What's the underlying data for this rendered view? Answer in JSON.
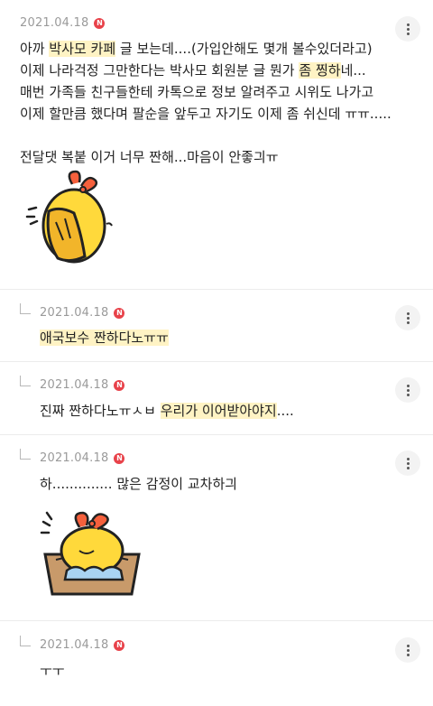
{
  "comments": [
    {
      "date": "2021.04.18",
      "badge": "N",
      "lines": [
        [
          "아까 ",
          {
            "hl": "박사모 카페"
          },
          " 글 보는데....(가입안해도 몇개 볼수있더라고)"
        ],
        [
          "이제 나라걱정 그만한다는 박사모 회원분 글 뭔가 ",
          {
            "hl": "좀 찡하"
          },
          "네..."
        ],
        [
          "매번 가족들 친구들한테 카톡으로 정보 알려주고 시위도 나가고"
        ],
        [
          "이제 할만큼 했다며 팔순을 앞두고 자기도 이제 좀 쉬신데 ㅠㅠ....."
        ],
        [
          ""
        ],
        [
          "전달댓 복붙 이거 너무 짠해...마음이 안좋긔ㅠ"
        ]
      ]
    },
    {
      "date": "2021.04.18",
      "badge": "N",
      "lines": [
        [
          {
            "hl": "애국보수 짠하다노ㅠㅠ"
          }
        ]
      ]
    },
    {
      "date": "2021.04.18",
      "badge": "N",
      "lines": [
        [
          "진짜 짠하다노ㅠㅅㅂ ",
          {
            "hl": "우리가 이어받아야지"
          },
          "...."
        ]
      ]
    },
    {
      "date": "2021.04.18",
      "badge": "N",
      "lines": [
        [
          "하.............. 많은 감정이 교차하긔"
        ]
      ]
    },
    {
      "date": "2021.04.18",
      "badge": "N",
      "lines": [
        [
          "ㅜㅜ"
        ]
      ]
    }
  ]
}
